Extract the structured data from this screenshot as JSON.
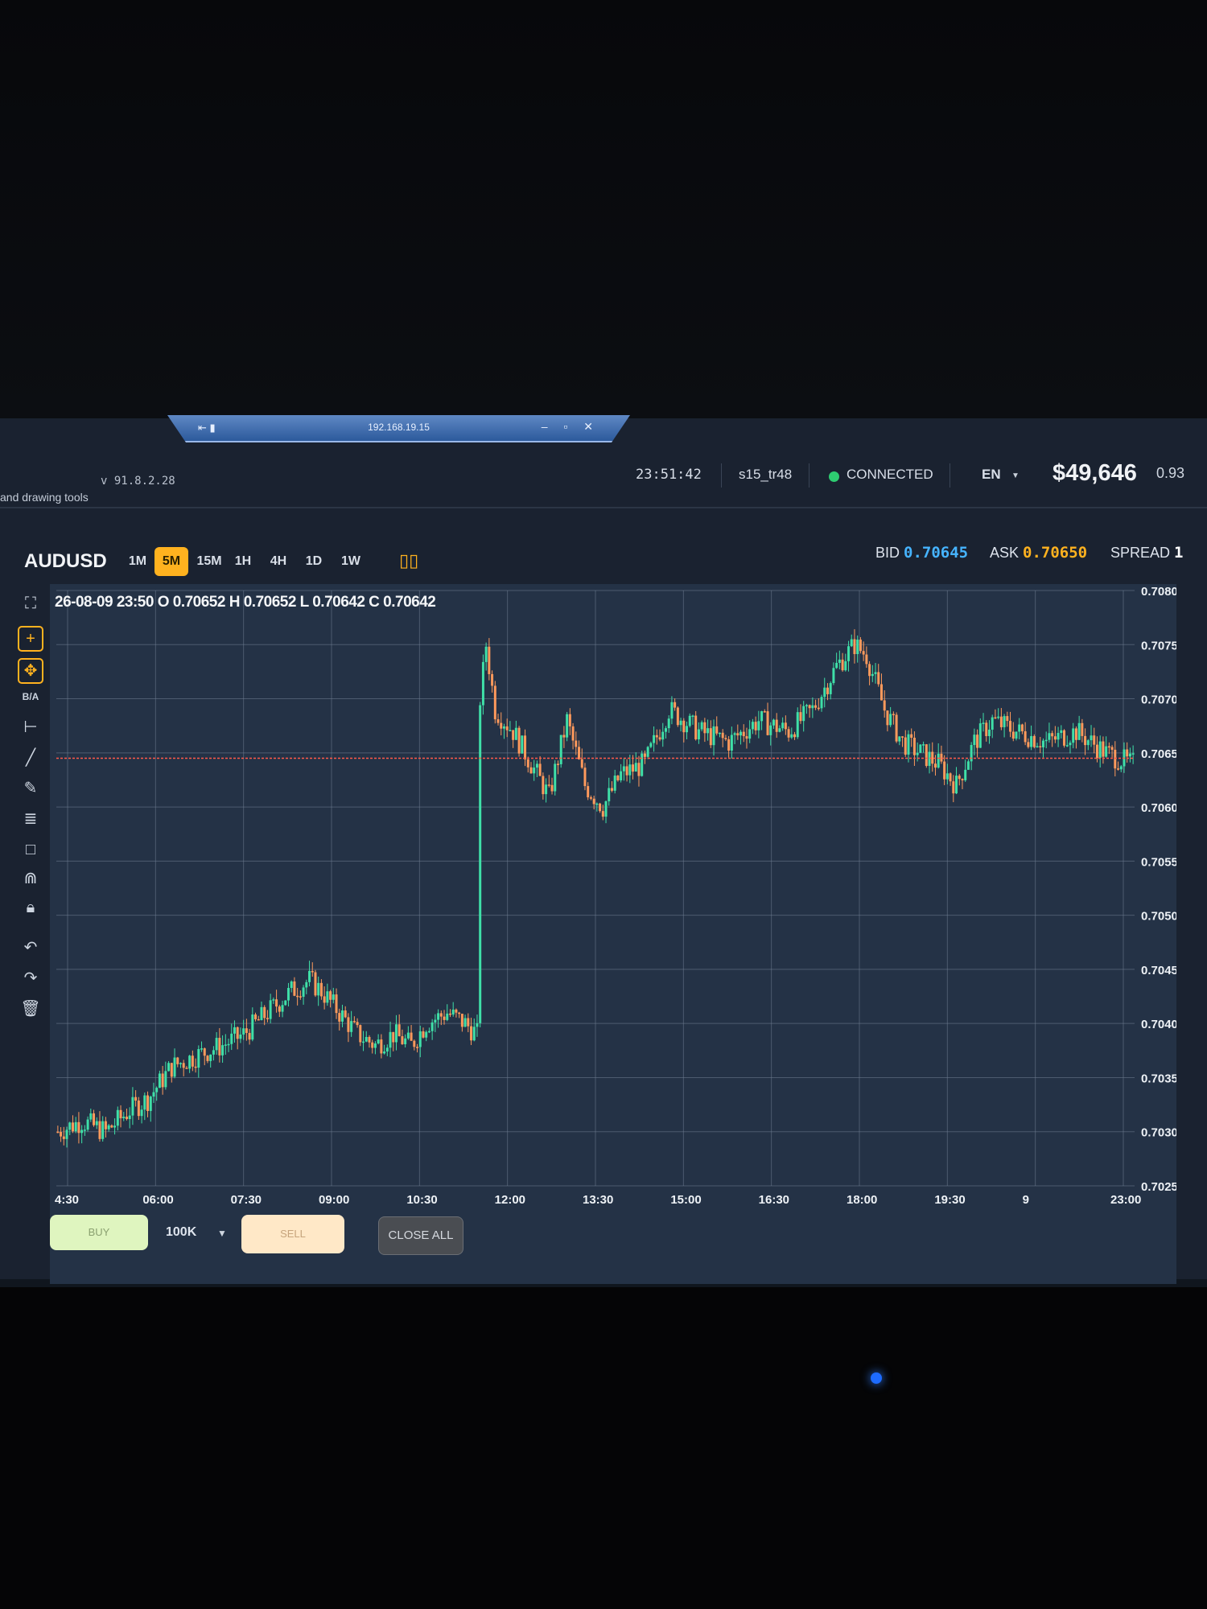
{
  "window": {
    "remote_host": "192.168.19.15",
    "remote_icons": "pin-signal",
    "version": "v 91.8.2.28",
    "drawing_tools_hint": "and drawing tools"
  },
  "header": {
    "time": "23:51:42",
    "user": "s15_tr48",
    "status": "CONNECTED",
    "language": "EN",
    "balance": "$49,646",
    "change": "0.93"
  },
  "toolbar": {
    "symbol": "AUDUSD",
    "timeframes": [
      "1M",
      "5M",
      "15M",
      "1H",
      "4H",
      "1D",
      "1W"
    ],
    "active_timeframe": "5M",
    "bid_label": "BID",
    "bid": "0.70645",
    "ask_label": "ASK",
    "ask": "0.70650",
    "spread_label": "SPREAD",
    "spread": "1"
  },
  "tools": {
    "ba_label": "B/A",
    "icons": [
      "fullscreen-icon",
      "crosshair-icon",
      "move-icon",
      "ba-label",
      "horizontal-line-icon",
      "trend-line-icon",
      "pencil-icon",
      "fib-icon",
      "rectangle-icon",
      "magnet-icon",
      "lock-icon",
      "undo-icon",
      "redo-icon",
      "trash-icon"
    ]
  },
  "ohlc_text": "26-08-09 23:50 O 0.70652 H 0.70652 L 0.70642 C 0.70642",
  "trading": {
    "buy_label": "BUY",
    "lot": "100K",
    "sell_label": "SELL",
    "close_all_label": "CLOSE ALL"
  },
  "colors": {
    "up": "#3fe0a8",
    "down": "#ff9a5c",
    "accent": "#ffb21f",
    "price_line": "#ff5a4a",
    "bid": "#46b4ff"
  },
  "chart_data": {
    "type": "candlestick",
    "ylim": [
      0.7025,
      0.708
    ],
    "y_ticks": [
      "0.70800",
      "0.70750",
      "0.70700",
      "0.70650",
      "0.70600",
      "0.70550",
      "0.70500",
      "0.70450",
      "0.70400",
      "0.70350",
      "0.70300",
      "0.70250"
    ],
    "x_ticks": [
      "4:30",
      "06:00",
      "07:30",
      "09:00",
      "10:30",
      "12:00",
      "13:30",
      "15:00",
      "16:30",
      "18:00",
      "19:30",
      "9",
      "23:00"
    ],
    "current_price": 0.70645,
    "close_path": [
      [
        0,
        0.703
      ],
      [
        8,
        0.7031
      ],
      [
        16,
        0.703
      ],
      [
        24,
        0.7032
      ],
      [
        30,
        0.7033
      ],
      [
        38,
        0.7036
      ],
      [
        46,
        0.7037
      ],
      [
        55,
        0.7038
      ],
      [
        62,
        0.7039
      ],
      [
        70,
        0.7041
      ],
      [
        78,
        0.7043
      ],
      [
        84,
        0.7044
      ],
      [
        88,
        0.7043
      ],
      [
        94,
        0.7041
      ],
      [
        100,
        0.7039
      ],
      [
        106,
        0.7038
      ],
      [
        112,
        0.7039
      ],
      [
        118,
        0.7038
      ],
      [
        123,
        0.704
      ],
      [
        130,
        0.7041
      ],
      [
        136,
        0.704
      ],
      [
        140,
        0.7039
      ],
      [
        141,
        0.707
      ],
      [
        143,
        0.7075
      ],
      [
        146,
        0.7069
      ],
      [
        152,
        0.7067
      ],
      [
        158,
        0.7064
      ],
      [
        164,
        0.7061
      ],
      [
        170,
        0.7068
      ],
      [
        176,
        0.7062
      ],
      [
        182,
        0.706
      ],
      [
        188,
        0.7063
      ],
      [
        196,
        0.7064
      ],
      [
        204,
        0.7069
      ],
      [
        214,
        0.7067
      ],
      [
        224,
        0.7066
      ],
      [
        234,
        0.7068
      ],
      [
        244,
        0.7067
      ],
      [
        252,
        0.7069
      ],
      [
        260,
        0.7073
      ],
      [
        266,
        0.7075
      ],
      [
        270,
        0.7074
      ],
      [
        276,
        0.7069
      ],
      [
        282,
        0.7066
      ],
      [
        288,
        0.7065
      ],
      [
        294,
        0.7064
      ],
      [
        300,
        0.7062
      ],
      [
        306,
        0.7066
      ],
      [
        312,
        0.7068
      ],
      [
        320,
        0.7067
      ],
      [
        330,
        0.7066
      ],
      [
        340,
        0.7067
      ],
      [
        350,
        0.7065
      ],
      [
        358,
        0.7064
      ]
    ],
    "total_bars": 360
  }
}
